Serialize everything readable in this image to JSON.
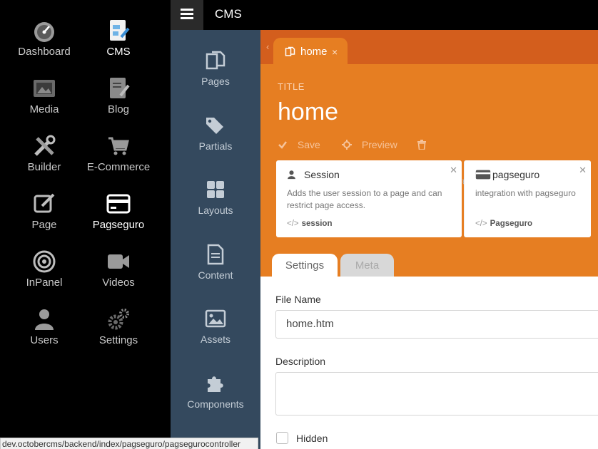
{
  "app_nav": {
    "items": [
      {
        "label": "Dashboard",
        "icon": "dashboard-icon"
      },
      {
        "label": "CMS",
        "icon": "cms-icon",
        "active": true
      },
      {
        "label": "Media",
        "icon": "media-icon"
      },
      {
        "label": "Blog",
        "icon": "blog-icon"
      },
      {
        "label": "Builder",
        "icon": "builder-icon"
      },
      {
        "label": "E-Commerce",
        "icon": "cart-icon"
      },
      {
        "label": "Page",
        "icon": "edit-icon"
      },
      {
        "label": "Pagseguro",
        "icon": "credit-card-icon",
        "active": true
      },
      {
        "label": "InPanel",
        "icon": "target-icon"
      },
      {
        "label": "Videos",
        "icon": "video-camera-icon"
      },
      {
        "label": "Users",
        "icon": "user-icon"
      },
      {
        "label": "Settings",
        "icon": "gears-icon"
      }
    ]
  },
  "topbar": {
    "title": "CMS"
  },
  "cms_nav": {
    "items": [
      {
        "label": "Pages",
        "icon": "pages-icon"
      },
      {
        "label": "Partials",
        "icon": "tags-icon"
      },
      {
        "label": "Layouts",
        "icon": "grid-icon"
      },
      {
        "label": "Content",
        "icon": "file-text-icon"
      },
      {
        "label": "Assets",
        "icon": "image-icon"
      },
      {
        "label": "Components",
        "icon": "puzzle-icon"
      }
    ]
  },
  "doc_tab": {
    "label": "home",
    "close": "×"
  },
  "editor": {
    "title_label": "TITLE",
    "title_value": "home",
    "save_label": "Save",
    "preview_label": "Preview"
  },
  "components": [
    {
      "name": "Session",
      "description": "Adds the user session to a page and can restrict page access.",
      "alias": "session",
      "icon": "user-icon"
    },
    {
      "name": "pagseguro",
      "description": "integration with pagseguro",
      "alias": "Pagseguro",
      "icon": "credit-card-icon"
    }
  ],
  "form_tabs": [
    {
      "label": "Settings",
      "active": true
    },
    {
      "label": "Meta",
      "active": false
    }
  ],
  "form": {
    "file_name_label": "File Name",
    "file_name_value": "home.htm",
    "description_label": "Description",
    "description_value": "",
    "hidden_label": "Hidden"
  },
  "status_bar": {
    "url": "dev.octobercms/backend/index/pagseguro/pagsegurocontroller"
  },
  "colors": {
    "accent": "#e67e22",
    "accent_dark": "#d35e1d",
    "sidebar": "#34495e"
  }
}
